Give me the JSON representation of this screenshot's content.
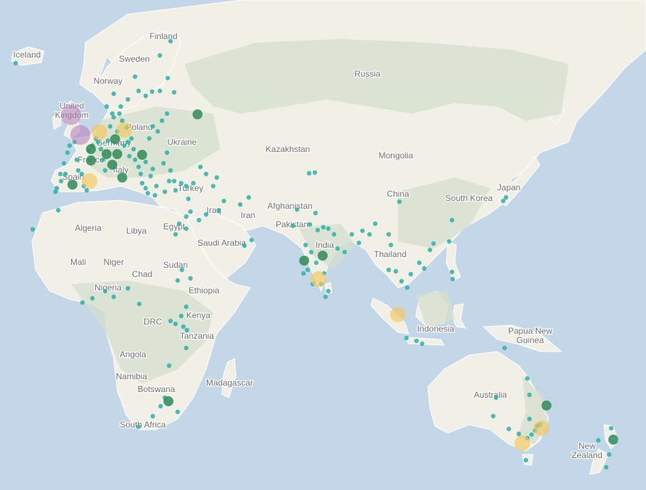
{
  "map": {
    "country_labels": [
      {
        "id": "iceland",
        "lines": [
          "Iceland"
        ]
      },
      {
        "id": "finland",
        "lines": [
          "Finland"
        ]
      },
      {
        "id": "sweden",
        "lines": [
          "Sweden"
        ]
      },
      {
        "id": "norway",
        "lines": [
          "Norway"
        ]
      },
      {
        "id": "russia",
        "lines": [
          "Russia"
        ]
      },
      {
        "id": "united-kingdom",
        "lines": [
          "United",
          "Kingdom"
        ]
      },
      {
        "id": "poland",
        "lines": [
          "Poland"
        ]
      },
      {
        "id": "germany",
        "lines": [
          "Germany"
        ]
      },
      {
        "id": "ukraine",
        "lines": [
          "Ukraine"
        ]
      },
      {
        "id": "france",
        "lines": [
          "France"
        ]
      },
      {
        "id": "italy",
        "lines": [
          "Italy"
        ]
      },
      {
        "id": "spain",
        "lines": [
          "Spain"
        ]
      },
      {
        "id": "turkey",
        "lines": [
          "Turkey"
        ]
      },
      {
        "id": "kazakhstan",
        "lines": [
          "Kazakhstan"
        ]
      },
      {
        "id": "mongolia",
        "lines": [
          "Mongolia"
        ]
      },
      {
        "id": "china",
        "lines": [
          "China"
        ]
      },
      {
        "id": "japan",
        "lines": [
          "Japan"
        ]
      },
      {
        "id": "south-korea",
        "lines": [
          "South Korea"
        ]
      },
      {
        "id": "afghanistan",
        "lines": [
          "Afghanistan"
        ]
      },
      {
        "id": "pakistan",
        "lines": [
          "Pakistan"
        ]
      },
      {
        "id": "iraq",
        "lines": [
          "Iraq"
        ]
      },
      {
        "id": "iran",
        "lines": [
          "Iran"
        ]
      },
      {
        "id": "algeria",
        "lines": [
          "Algeria"
        ]
      },
      {
        "id": "libya",
        "lines": [
          "Libya"
        ]
      },
      {
        "id": "egypt",
        "lines": [
          "Egypt"
        ]
      },
      {
        "id": "saudi-arabia",
        "lines": [
          "Saudi Arabia"
        ]
      },
      {
        "id": "india",
        "lines": [
          "India"
        ]
      },
      {
        "id": "thailand",
        "lines": [
          "Thailand"
        ]
      },
      {
        "id": "mali",
        "lines": [
          "Mali"
        ]
      },
      {
        "id": "niger",
        "lines": [
          "Niger"
        ]
      },
      {
        "id": "chad",
        "lines": [
          "Chad"
        ]
      },
      {
        "id": "sudan",
        "lines": [
          "Sudan"
        ]
      },
      {
        "id": "nigeria",
        "lines": [
          "Nigeria"
        ]
      },
      {
        "id": "ethiopia",
        "lines": [
          "Ethiopia"
        ]
      },
      {
        "id": "drc",
        "lines": [
          "DRC"
        ]
      },
      {
        "id": "kenya",
        "lines": [
          "Kenya"
        ]
      },
      {
        "id": "tanzania",
        "lines": [
          "Tanzania"
        ]
      },
      {
        "id": "indonesia",
        "lines": [
          "Indonesia"
        ]
      },
      {
        "id": "papua-new-guinea",
        "lines": [
          "Papua New",
          "Guinea"
        ]
      },
      {
        "id": "angola",
        "lines": [
          "Angola"
        ]
      },
      {
        "id": "namibia",
        "lines": [
          "Namibia"
        ]
      },
      {
        "id": "botswana",
        "lines": [
          "Botswana"
        ]
      },
      {
        "id": "madagascar",
        "lines": [
          "Madagascar"
        ]
      },
      {
        "id": "south-africa",
        "lines": [
          "South Africa"
        ]
      },
      {
        "id": "australia",
        "lines": [
          "Australia"
        ]
      },
      {
        "id": "new-zealand",
        "lines": [
          "New",
          "Zealand"
        ]
      }
    ],
    "marker_colors": {
      "small": "#2ab3a8",
      "medium": "#2e8b57",
      "large": "#f2c75c",
      "xlarge": "#b57ab8"
    },
    "colors": {
      "ocean": "#c4d7e9",
      "land": "#f2f0e6",
      "vegetation": "#d4dfcd",
      "label_text": "#6f6f6f"
    }
  }
}
